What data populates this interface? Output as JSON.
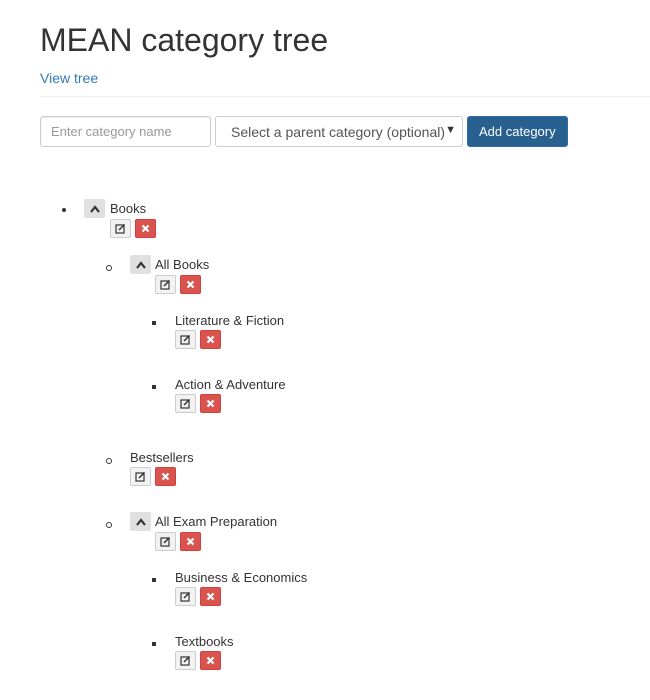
{
  "header": {
    "title": "MEAN category tree",
    "view_tree_link": "View tree"
  },
  "form": {
    "name_placeholder": "Enter category name",
    "parent_select_value": "Select a parent category (optional)",
    "add_button_label": "Add category"
  },
  "tree": {
    "books": "Books",
    "all_books": "All Books",
    "literature_fiction": "Literature & Fiction",
    "action_adventure": "Action & Adventure",
    "bestsellers": "Bestsellers",
    "all_exam_preparation": "All Exam Preparation",
    "business_economics": "Business & Economics",
    "textbooks": "Textbooks"
  },
  "icons": {
    "collapse": "chevron-up-icon",
    "edit": "edit-icon",
    "delete": "delete-x-icon"
  },
  "colors": {
    "link": "#337ab7",
    "primary_button": "#286090",
    "danger_button": "#d9534f"
  }
}
